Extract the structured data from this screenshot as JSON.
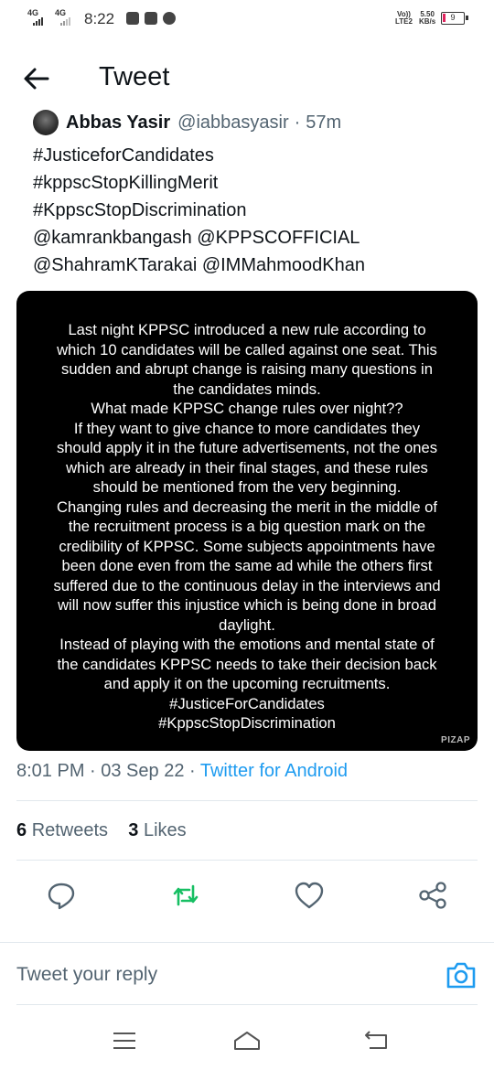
{
  "status_bar": {
    "net1": "4G",
    "net2": "4G",
    "time": "8:22",
    "volte_top": "Vo))",
    "volte_bottom": "LTE2",
    "speed_top": "5.50",
    "speed_bottom": "KB/s",
    "battery": "9",
    "notification_icons": [
      "message-icon",
      "youtube-icon",
      "phone-icon"
    ]
  },
  "header": {
    "title": "Tweet",
    "back_icon": "arrow-left-icon"
  },
  "tweet": {
    "author_name": "Abbas Yasir",
    "author_handle": "@iabbasyasir",
    "separator": "·",
    "time_ago": "57m",
    "lines": [
      "#JusticeforCandidates",
      "#kppscStopKillingMerit",
      "#KppscStopDiscrimination",
      "@kamrankbangash @KPPSCOFFICIAL",
      "@ShahramKTarakai @IMMahmoodKhan"
    ],
    "image": {
      "lines": [
        "Last night KPPSC introduced a new rule according to",
        "which 10 candidates will be called against one seat. This",
        "sudden and abrupt change is raising many questions in",
        "the candidates minds.",
        "What made KPPSC change rules over night??",
        "If they want to give chance to more candidates they",
        "should apply it in the future advertisements, not the ones",
        "which are already in their final stages, and these rules",
        "should be mentioned from the very beginning.",
        "Changing rules and decreasing the merit in the middle of",
        "the recruitment process is a big question mark on the",
        "credibility of KPPSC. Some subjects appointments have",
        "been done even from the same ad while the others first",
        "suffered due to the continuous delay in the interviews and",
        "will now suffer this injustice which is being done in broad",
        "daylight.",
        "Instead of playing with the emotions and mental state of",
        "the candidates KPPSC needs to take their decision back",
        "and apply it on the upcoming recruitments.",
        "#JusticeForCandidates",
        "#KppscStopDiscrimination"
      ],
      "watermark": "PIZAP"
    },
    "timestamp": "8:01 PM · 03 Sep 22 · ",
    "source": "Twitter for Android",
    "retweets_count": "6",
    "retweets_label": "Retweets",
    "likes_count": "3",
    "likes_label": "Likes"
  },
  "actions": {
    "icons": [
      "reply-icon",
      "retweet-icon",
      "like-icon",
      "share-icon"
    ],
    "retweet_color": "#17bf63",
    "icon_color": "#536471"
  },
  "reply_bar": {
    "placeholder": "Tweet your reply",
    "camera_color": "#1d9bf0"
  },
  "nav_bar": {
    "icons": [
      "menu-icon",
      "home-icon",
      "back-icon"
    ]
  }
}
